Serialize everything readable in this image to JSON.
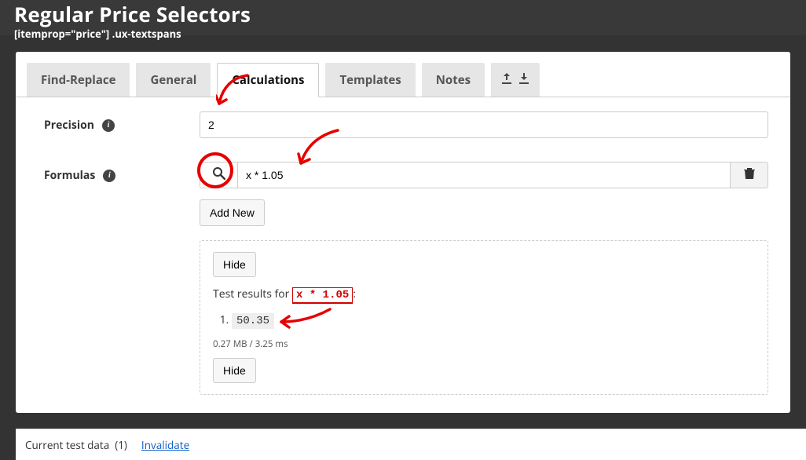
{
  "header": {
    "title": "Regular Price Selectors",
    "subtitle": "[itemprop=\"price\"] .ux-textspans"
  },
  "tabs": {
    "find_replace": "Find-Replace",
    "general": "General",
    "calculations": "Calculations",
    "templates": "Templates",
    "notes": "Notes"
  },
  "labels": {
    "precision": "Precision",
    "formulas": "Formulas"
  },
  "fields": {
    "precision_value": "2",
    "formula_value": "x * 1.05"
  },
  "buttons": {
    "add_new": "Add New",
    "hide": "Hide"
  },
  "results": {
    "prefix": "Test results for ",
    "formula": "x * 1.05",
    "colon": ":",
    "items": [
      "50.35"
    ],
    "stats": "0.27 MB / 3.25 ms"
  },
  "footer": {
    "current_label": "Current test data",
    "count": "(1)",
    "invalidate": "Invalidate"
  }
}
